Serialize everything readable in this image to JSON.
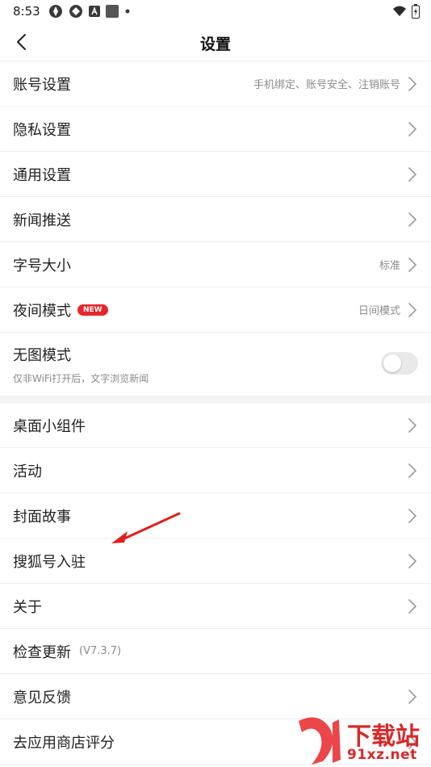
{
  "status_bar": {
    "time": "8:53",
    "icons": [
      "network-a-icon",
      "network-b-icon",
      "a-badge-icon",
      "square-app-icon",
      "dot-icon"
    ],
    "right_icons": [
      "wifi-icon",
      "battery-charging-icon"
    ]
  },
  "nav": {
    "title": "设置"
  },
  "group1": {
    "account": {
      "label": "账号设置",
      "value": "手机绑定、账号安全、注销账号"
    },
    "privacy": {
      "label": "隐私设置"
    },
    "general": {
      "label": "通用设置"
    },
    "news_push": {
      "label": "新闻推送"
    },
    "font_size": {
      "label": "字号大小",
      "value": "标准"
    },
    "night_mode": {
      "label": "夜间模式",
      "badge": "NEW",
      "value": "日间模式"
    },
    "no_image": {
      "label": "无图模式",
      "sublabel": "仅非WiFi打开后，文字浏览新闻",
      "enabled": false
    }
  },
  "group2": {
    "widget": {
      "label": "桌面小组件"
    },
    "activity": {
      "label": "活动"
    },
    "cover_story": {
      "label": "封面故事"
    },
    "sohu_account": {
      "label": "搜狐号入驻"
    },
    "about": {
      "label": "关于"
    },
    "check_update": {
      "label": "检查更新",
      "version": "(V7.3.7)"
    },
    "feedback": {
      "label": "意见反馈"
    },
    "rate_app": {
      "label": "去应用商店评分"
    }
  },
  "watermark": {
    "title": "下载站",
    "site": "91xz.net"
  },
  "colors": {
    "accent_red": "#e8262a",
    "divider": "#ededed",
    "secondary_text": "#8a8a8a"
  }
}
